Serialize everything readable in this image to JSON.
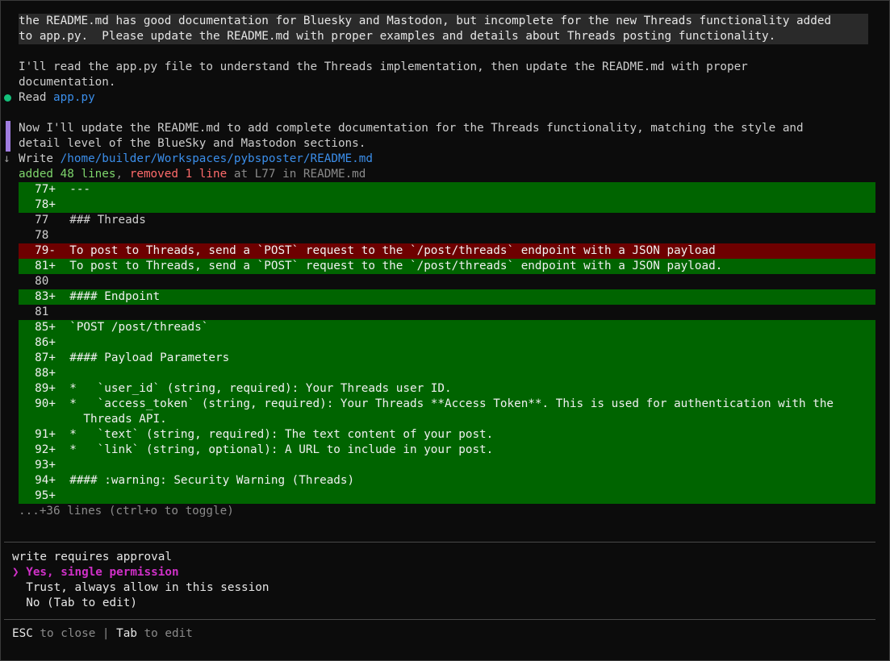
{
  "prompt": {
    "line1": "the README.md has good documentation for Bluesky and Mastodon, but incomplete for the new Threads functionality added",
    "line2": "to app.py.  Please update the README.md with proper examples and details about Threads posting functionality."
  },
  "assistant": {
    "msg1_line1": "I'll read the app.py file to understand the Threads implementation, then update the README.md with proper",
    "msg1_line2": "documentation.",
    "read_label": "Read",
    "read_file": "app.py",
    "msg2_line1": "Now I'll update the README.md to add complete documentation for the Threads functionality, matching the style and",
    "msg2_line2": "detail level of the BlueSky and Mastodon sections.",
    "write_label": "Write",
    "write_path": "/home/builder/Workspaces/pybsposter/README.md",
    "summary_added": "added 48 lines",
    "summary_sep": ", ",
    "summary_removed": "removed 1 line",
    "summary_rest": " at L77 in README.md"
  },
  "icons": {
    "read_status": "green-dot-icon",
    "write_status": "down-arrow-icon",
    "arrow_glyph": "↓"
  },
  "diff": [
    {
      "type": "add",
      "num": "77+",
      "text": "  ---"
    },
    {
      "type": "add",
      "num": "78+",
      "text": ""
    },
    {
      "type": "ctx",
      "num": "77 ",
      "text": "  ### Threads"
    },
    {
      "type": "ctx",
      "num": "78 ",
      "text": ""
    },
    {
      "type": "del",
      "num": "79-",
      "text": "  To post to Threads, send a `POST` request to the `/post/threads` endpoint with a JSON payload"
    },
    {
      "type": "add",
      "num": "81+",
      "text": "  To post to Threads, send a `POST` request to the `/post/threads` endpoint with a JSON payload."
    },
    {
      "type": "ctx",
      "num": "80 ",
      "text": ""
    },
    {
      "type": "add",
      "num": "83+",
      "text": "  #### Endpoint"
    },
    {
      "type": "ctx",
      "num": "81 ",
      "text": ""
    },
    {
      "type": "add",
      "num": "85+",
      "text": "  `POST /post/threads`"
    },
    {
      "type": "add",
      "num": "86+",
      "text": ""
    },
    {
      "type": "add",
      "num": "87+",
      "text": "  #### Payload Parameters"
    },
    {
      "type": "add",
      "num": "88+",
      "text": ""
    },
    {
      "type": "add",
      "num": "89+",
      "text": "  *   `user_id` (string, required): Your Threads user ID."
    },
    {
      "type": "add",
      "num": "90+",
      "text": "  *   `access_token` (string, required): Your Threads **Access Token**. This is used for authentication with the"
    },
    {
      "type": "add",
      "num": "",
      "text": "    Threads API."
    },
    {
      "type": "add",
      "num": "91+",
      "text": "  *   `text` (string, required): The text content of your post."
    },
    {
      "type": "add",
      "num": "92+",
      "text": "  *   `link` (string, optional): A URL to include in your post."
    },
    {
      "type": "add",
      "num": "93+",
      "text": ""
    },
    {
      "type": "add",
      "num": "94+",
      "text": "  #### :warning: Security Warning (Threads)"
    },
    {
      "type": "add",
      "num": "95+",
      "text": ""
    }
  ],
  "more_lines": "...+36 lines (ctrl+o to toggle)",
  "approval": {
    "title": "write requires approval",
    "options": [
      {
        "label": "❯ Yes, single permission",
        "selected": true
      },
      {
        "label": "  Trust, always allow in this session",
        "selected": false
      },
      {
        "label": "  No (Tab to edit)",
        "selected": false
      }
    ]
  },
  "footer": {
    "esc_key": "ESC",
    "esc_action": " to close ",
    "sep": "|",
    "tab_key": " Tab",
    "tab_action": " to edit"
  },
  "colors": {
    "background": "#0c0c0c",
    "diff_add": "#006400",
    "diff_del": "#6e0000",
    "link": "#3b8eea",
    "selected_option": "#d030c8",
    "read_dot": "#13c07a",
    "message_bar": "#a07de0"
  }
}
